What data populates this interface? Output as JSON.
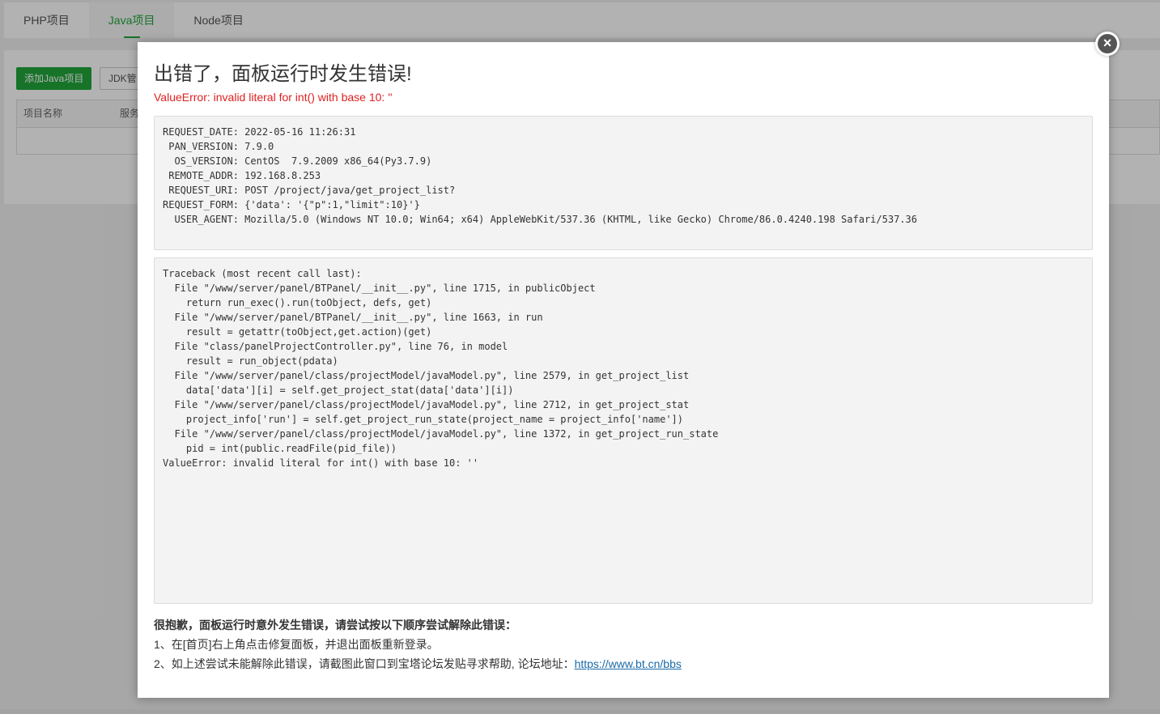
{
  "tabs": [
    {
      "label": "PHP项目",
      "active": false
    },
    {
      "label": "Java项目",
      "active": true
    },
    {
      "label": "Node项目",
      "active": false
    }
  ],
  "toolbar": {
    "add_label": "添加Java项目",
    "jdk_label": "JDK管"
  },
  "table": {
    "headers": [
      "项目名称",
      "服务"
    ]
  },
  "modal": {
    "close_symbol": "×",
    "title": "出错了，面板运行时发生错误!",
    "error_message": "ValueError: invalid literal for int() with base 10: ''",
    "request_lines": [
      "REQUEST_DATE: 2022-05-16 11:26:31",
      " PAN_VERSION: 7.9.0",
      "  OS_VERSION: CentOS  7.9.2009 x86_64(Py3.7.9)",
      " REMOTE_ADDR: 192.168.8.253",
      " REQUEST_URI: POST /project/java/get_project_list?",
      "REQUEST_FORM: {'data': '{\"p\":1,\"limit\":10}'}",
      "  USER_AGENT: Mozilla/5.0 (Windows NT 10.0; Win64; x64) AppleWebKit/537.36 (KHTML, like Gecko) Chrome/86.0.4240.198 Safari/537.36"
    ],
    "traceback_lines": [
      "Traceback (most recent call last):",
      "  File \"/www/server/panel/BTPanel/__init__.py\", line 1715, in publicObject",
      "    return run_exec().run(toObject, defs, get)",
      "  File \"/www/server/panel/BTPanel/__init__.py\", line 1663, in run",
      "    result = getattr(toObject,get.action)(get)",
      "  File \"class/panelProjectController.py\", line 76, in model",
      "    result = run_object(pdata)",
      "  File \"/www/server/panel/class/projectModel/javaModel.py\", line 2579, in get_project_list",
      "    data['data'][i] = self.get_project_stat(data['data'][i])",
      "  File \"/www/server/panel/class/projectModel/javaModel.py\", line 2712, in get_project_stat",
      "    project_info['run'] = self.get_project_run_state(project_name = project_info['name'])",
      "  File \"/www/server/panel/class/projectModel/javaModel.py\", line 1372, in get_project_run_state",
      "    pid = int(public.readFile(pid_file))",
      "ValueError: invalid literal for int() with base 10: ''"
    ],
    "help_title": "很抱歉，面板运行时意外发生错误，请尝试按以下顺序尝试解除此错误：",
    "help_step1": "1、在[首页]右上角点击修复面板，并退出面板重新登录。",
    "help_step2": "2、如上述尝试未能解除此错误，请截图此窗口到宝塔论坛发贴寻求帮助, 论坛地址：",
    "forum_link": "https://www.bt.cn/bbs"
  }
}
